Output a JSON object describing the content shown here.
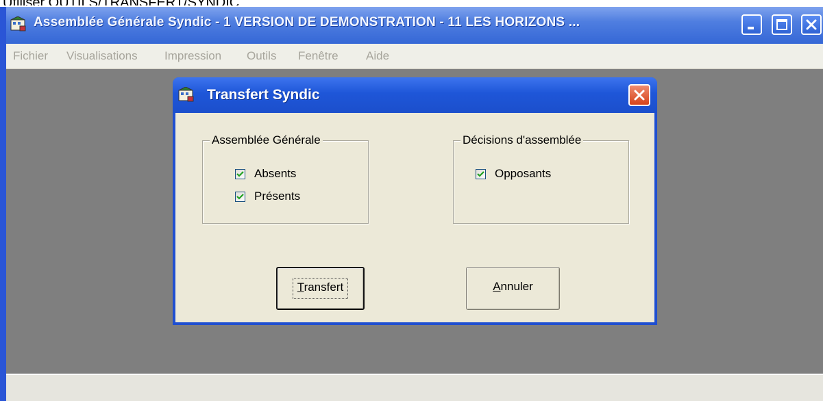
{
  "caption": {
    "text": "Utiliser OUTILS/TRANSFERT/SYNDIC"
  },
  "window": {
    "title": "Assemblée Générale Syndic  - 1  VERSION DE DEMONSTRATION - 11  LES HORIZONS  ...",
    "title_bar_color": "#3567d6",
    "workspace_color": "#7f7f7f",
    "buttons": [
      "minimize-icon",
      "maximize-icon",
      "close-icon"
    ]
  },
  "menu": {
    "items": [
      "Fichier",
      "Visualisations",
      "Impression",
      "Outils",
      "Fenêtre",
      "Aide"
    ],
    "state": "disabled"
  },
  "dialog": {
    "title": "Transfert Syndic",
    "group_assemblee": {
      "legend": "Assemblée Générale",
      "checkboxes": [
        {
          "label": "Absents",
          "checked": true
        },
        {
          "label": "Présents",
          "checked": true
        }
      ]
    },
    "group_decisions": {
      "legend": "Décisions d'assemblée",
      "checkboxes": [
        {
          "label": "Opposants",
          "checked": true
        }
      ]
    },
    "buttons": {
      "transfert": {
        "mnemonic": "T",
        "rest": "ransfert",
        "default": true
      },
      "annuler": {
        "mnemonic": "A",
        "rest": "nnuler"
      }
    }
  }
}
